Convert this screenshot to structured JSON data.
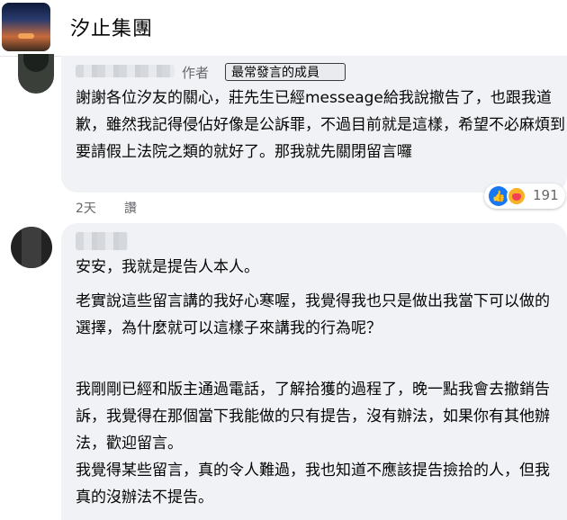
{
  "group": {
    "name": "汐止集團"
  },
  "comment1": {
    "author_tag": "作者",
    "badge": "最常發言的成員",
    "text": "謝謝各位汐友的關心，莊先生已經messeage給我說撤告了，也跟我道歉，雖然我記得侵佔好像是公訴罪，不過目前就是這樣，希望不必麻煩到要請假上法院之類的就好了。那我就先關閉留言囉",
    "time": "2天",
    "like_label": "讚",
    "reaction_count": "191",
    "reaction_icons": [
      "like-icon",
      "care-icon"
    ]
  },
  "comment2": {
    "paragraphs": [
      "安安，我就是提告人本人。",
      "老實說這些留言講的我好心寒喔，我覺得我也只是做出我當下可以做的選擇，為什麼就可以這樣子來講我的行為呢？",
      "我剛剛已經和版主通過電話，了解拾獲的過程了，晚一點我會去撤銷告訴，我覺得在那個當下我能做的只有提告，沒有辦法，如果你有其他辦法，歡迎留言。",
      "我覺得某些留言，真的令人難過，我也知道不應該提告撿拾的人，但我真的沒辦法不提告。"
    ]
  },
  "colors": {
    "bubble": "#f0f2f5",
    "meta_text": "#65676b",
    "like_blue": "#1877f2",
    "care_yellow": "#f7b125"
  }
}
